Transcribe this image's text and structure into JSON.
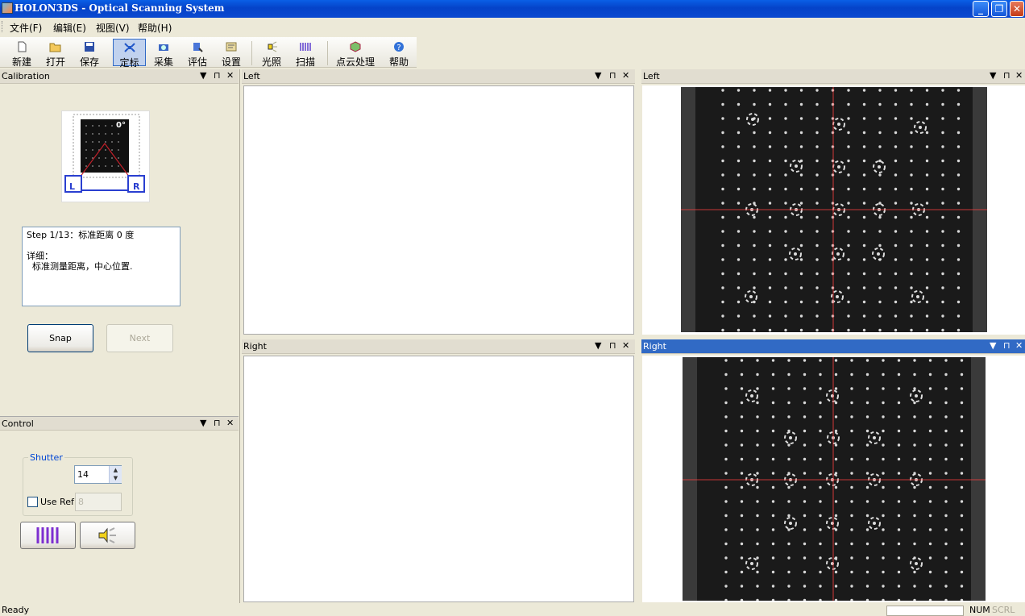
{
  "title": "HOLON3DS - Optical Scanning System",
  "menu": [
    "文件(F)",
    "编辑(E)",
    "视图(V)",
    "帮助(H)"
  ],
  "toolbar": [
    {
      "label": "新建",
      "icon": "new-file-icon"
    },
    {
      "label": "打开",
      "icon": "open-folder-icon"
    },
    {
      "label": "保存",
      "icon": "save-disk-icon"
    },
    {
      "label": "定标",
      "icon": "calibrate-icon",
      "active": true
    },
    {
      "label": "采集",
      "icon": "capture-icon"
    },
    {
      "label": "评估",
      "icon": "evaluate-icon"
    },
    {
      "label": "设置",
      "icon": "settings-icon"
    },
    {
      "label": "光照",
      "icon": "light-icon"
    },
    {
      "label": "扫描",
      "icon": "scan-icon"
    },
    {
      "label": "点云处理",
      "icon": "point-cloud-icon"
    },
    {
      "label": "帮助",
      "icon": "help-icon"
    }
  ],
  "calibration": {
    "title": "Calibration",
    "angle": "0°",
    "cam_left": "L",
    "cam_right": "R",
    "step_line": "Step 1/13：标准距离 0 度",
    "detail_label": "详细：",
    "detail_text": "  标准测量距离，中心位置.",
    "snap_label": "Snap",
    "next_label": "Next"
  },
  "control": {
    "title": "Control",
    "group_label": "Shutter",
    "shutter_value": "14",
    "use_ref_label": "Use Ref",
    "ref_value": "8"
  },
  "views": {
    "left1": "Left",
    "right1": "Right",
    "left2": "Left",
    "right2": "Right"
  },
  "status": {
    "text": "Ready",
    "num": "NUM",
    "scrl": "SCRL"
  },
  "colors": {
    "title_bar": "#0543c9",
    "active_pane": "#316ac5",
    "crosshair": "#ff4040",
    "stripe_button": "#7d2fd0"
  }
}
